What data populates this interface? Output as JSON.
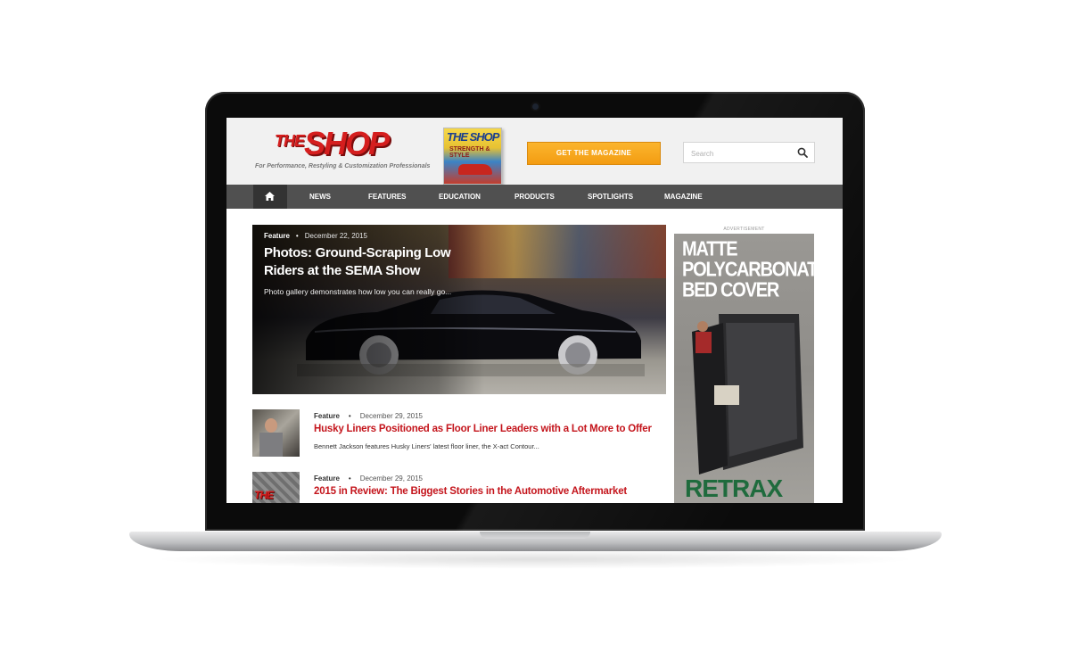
{
  "site": {
    "logo_the": "THE",
    "logo_shop": "SHOP",
    "tagline": "For Performance, Restyling & Customization Professionals",
    "magazine_cover": {
      "title": "THE SHOP",
      "subtitle": "STRENGTH & STYLE"
    },
    "get_magazine_label": "GET THE MAGAZINE",
    "search_placeholder": "Search"
  },
  "nav": {
    "items": [
      "NEWS",
      "FEATURES",
      "EDUCATION",
      "PRODUCTS",
      "SPOTLIGHTS",
      "MAGAZINE"
    ]
  },
  "hero": {
    "category": "Feature",
    "separator": "•",
    "date": "December 22, 2015",
    "title": "Photos: Ground-Scraping Low Riders at the SEMA Show",
    "excerpt": "Photo gallery demonstrates how low you can really go..."
  },
  "articles": [
    {
      "category": "Feature",
      "separator": "•",
      "date": "December 29, 2015",
      "title": "Husky Liners Positioned as Floor Liner Leaders with a Lot More to Offer",
      "excerpt": "Bennett Jackson features Husky Liners' latest floor liner, the X-act Contour..."
    },
    {
      "category": "Feature",
      "separator": "•",
      "date": "December 29, 2015",
      "title": "2015 in Review: The Biggest Stories in the Automotive Aftermarket",
      "thumb_text": "THE SHOP"
    }
  ],
  "ad": {
    "label": "ADVERTISEMENT",
    "headline": "MATTE POLYCARBONATE BED COVER",
    "brand": "RETRAX"
  },
  "colors": {
    "brand_red": "#c4151c",
    "nav_bg": "#505050",
    "cta_orange": "#f39c12"
  },
  "icons": [
    "search-icon",
    "home-icon"
  ]
}
